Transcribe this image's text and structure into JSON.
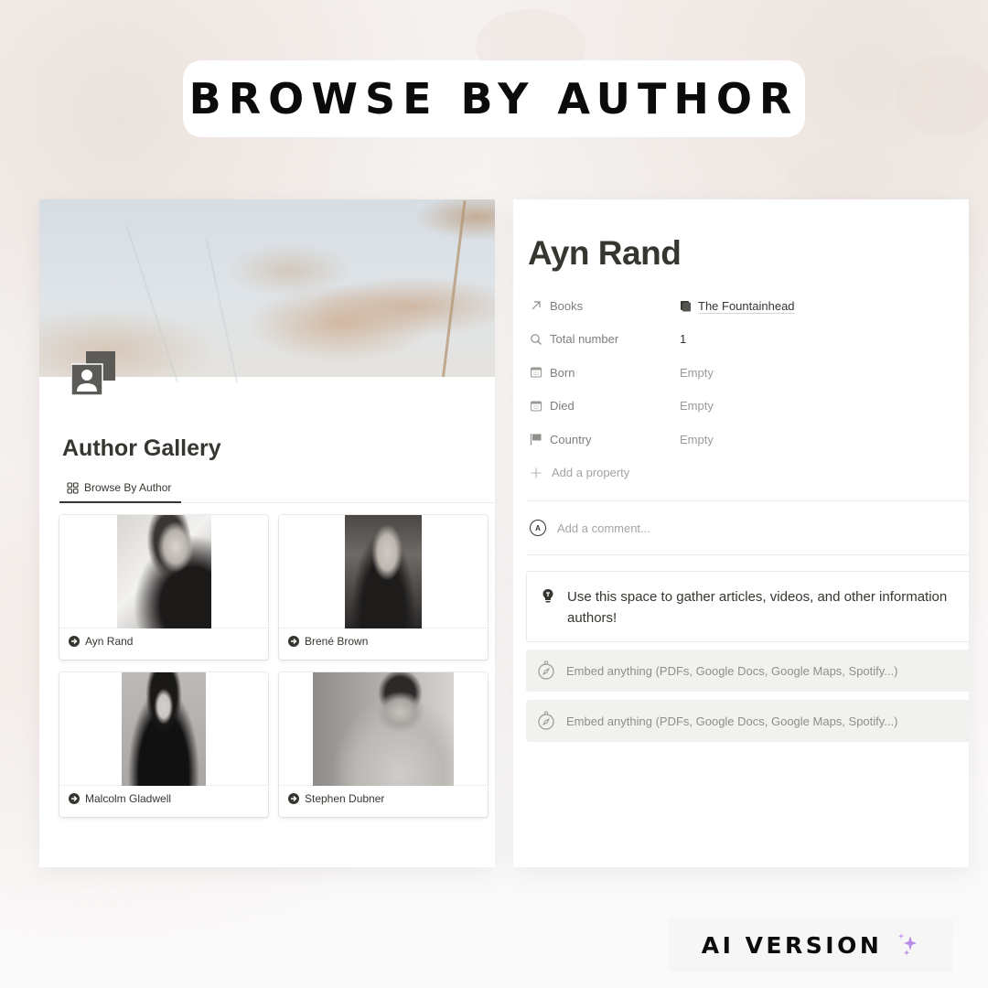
{
  "banner": {
    "title": "BROWSE BY AUTHOR"
  },
  "gallery_page": {
    "icon": "contact-card-icon",
    "title": "Author Gallery",
    "tabs": [
      {
        "label": "Browse By Author",
        "icon": "gallery-grid-icon",
        "active": true
      }
    ],
    "cards": [
      {
        "name": "Ayn Rand",
        "icon": "arrow-right-circle-icon",
        "photo": "black-and-white portrait"
      },
      {
        "name": "Brené Brown",
        "icon": "arrow-right-circle-icon",
        "photo": "black-and-white portrait"
      },
      {
        "name": "Malcolm Gladwell",
        "icon": "arrow-right-circle-icon",
        "photo": "black-and-white portrait"
      },
      {
        "name": "Stephen Dubner",
        "icon": "arrow-right-circle-icon",
        "photo": "black-and-white portrait"
      }
    ]
  },
  "author_page": {
    "title": "Ayn Rand",
    "properties": [
      {
        "name": "Books",
        "icon": "relation-arrow-icon",
        "value": "The Fountainhead",
        "value_icon": "book-icon",
        "empty": false
      },
      {
        "name": "Total number",
        "icon": "rollup-search-icon",
        "value": "1",
        "empty": false
      },
      {
        "name": "Born",
        "icon": "calendar-icon",
        "value": "Empty",
        "empty": true
      },
      {
        "name": "Died",
        "icon": "calendar-icon",
        "value": "Empty",
        "empty": true
      },
      {
        "name": "Country",
        "icon": "flag-icon",
        "value": "Empty",
        "empty": true
      }
    ],
    "add_property_label": "Add a property",
    "comment": {
      "avatar_initial": "A",
      "placeholder": "Add a comment..."
    },
    "callout": {
      "icon": "lightbulb-icon",
      "text": "Use this space to gather articles, videos, and other information authors!"
    },
    "embeds": [
      {
        "icon": "compass-icon",
        "label": "Embed anything (PDFs, Google Docs, Google Maps, Spotify...)"
      },
      {
        "icon": "compass-icon",
        "label": "Embed anything (PDFs, Google Docs, Google Maps, Spotify...)"
      }
    ]
  },
  "badge": {
    "label": "AI VERSION",
    "icon": "sparkles-icon",
    "accent": "#b98ee6"
  }
}
